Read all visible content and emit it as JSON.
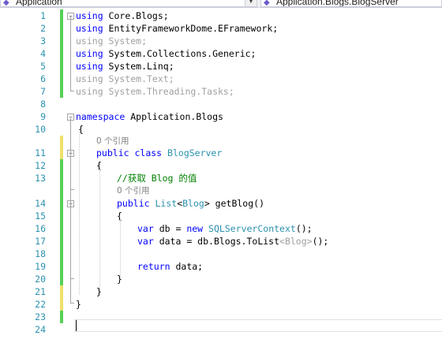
{
  "navigation": {
    "project_combo": "Application",
    "type_combo": "Application.Blogs.BlogServer"
  },
  "code_lines": [
    {
      "num": "1",
      "tokens": [
        {
          "t": "using",
          "c": "kw"
        },
        {
          "t": " Core.Blogs;",
          "c": ""
        }
      ]
    },
    {
      "num": "2",
      "tokens": [
        {
          "t": "using",
          "c": "kw"
        },
        {
          "t": " EntityFrameworkDome.EFramework;",
          "c": ""
        }
      ]
    },
    {
      "num": "3",
      "tokens": [
        {
          "t": "using System;",
          "c": "faded"
        }
      ]
    },
    {
      "num": "4",
      "tokens": [
        {
          "t": "using",
          "c": "kw"
        },
        {
          "t": " System.Collections.Generic;",
          "c": ""
        }
      ]
    },
    {
      "num": "5",
      "tokens": [
        {
          "t": "using",
          "c": "kw"
        },
        {
          "t": " System.Linq;",
          "c": ""
        }
      ]
    },
    {
      "num": "6",
      "tokens": [
        {
          "t": "using System.Text;",
          "c": "faded"
        }
      ]
    },
    {
      "num": "7",
      "tokens": [
        {
          "t": "using System.Threading.Tasks;",
          "c": "faded"
        }
      ]
    },
    {
      "num": "8",
      "tokens": []
    },
    {
      "num": "9",
      "tokens": [
        {
          "t": "namespace",
          "c": "kw"
        },
        {
          "t": " Application.Blogs",
          "c": ""
        }
      ]
    },
    {
      "num": "10",
      "tokens": [
        {
          "t": "{",
          "c": ""
        }
      ]
    },
    {
      "num": "11",
      "tokens": [
        {
          "t": "public",
          "c": "kw"
        },
        {
          "t": " ",
          "c": ""
        },
        {
          "t": "class",
          "c": "kw"
        },
        {
          "t": " ",
          "c": ""
        },
        {
          "t": "BlogServer",
          "c": "type"
        }
      ]
    },
    {
      "num": "12",
      "tokens": [
        {
          "t": "{",
          "c": ""
        }
      ]
    },
    {
      "num": "13",
      "tokens": [
        {
          "t": "//获取 Blog 的值",
          "c": "cmt"
        }
      ]
    },
    {
      "num": "14",
      "tokens": [
        {
          "t": "public",
          "c": "kw"
        },
        {
          "t": " ",
          "c": ""
        },
        {
          "t": "List",
          "c": "type"
        },
        {
          "t": "<",
          "c": ""
        },
        {
          "t": "Blog",
          "c": "type"
        },
        {
          "t": "> getBlog()",
          "c": ""
        }
      ]
    },
    {
      "num": "15",
      "tokens": [
        {
          "t": "{",
          "c": ""
        }
      ]
    },
    {
      "num": "16",
      "tokens": [
        {
          "t": "var",
          "c": "kw"
        },
        {
          "t": " db = ",
          "c": ""
        },
        {
          "t": "new",
          "c": "kw"
        },
        {
          "t": " ",
          "c": ""
        },
        {
          "t": "SQLServerContext",
          "c": "type"
        },
        {
          "t": "();",
          "c": ""
        }
      ]
    },
    {
      "num": "17",
      "tokens": [
        {
          "t": "var",
          "c": "kw"
        },
        {
          "t": " data = db.Blogs.ToList",
          "c": ""
        },
        {
          "t": "<Blog>",
          "c": "faded"
        },
        {
          "t": "();",
          "c": ""
        }
      ]
    },
    {
      "num": "18",
      "tokens": []
    },
    {
      "num": "19",
      "tokens": [
        {
          "t": "return",
          "c": "kw"
        },
        {
          "t": " data;",
          "c": ""
        }
      ]
    },
    {
      "num": "20",
      "tokens": [
        {
          "t": "}",
          "c": ""
        }
      ]
    },
    {
      "num": "21",
      "tokens": [
        {
          "t": "}",
          "c": ""
        }
      ]
    },
    {
      "num": "22",
      "tokens": [
        {
          "t": "}",
          "c": ""
        }
      ]
    },
    {
      "num": "23",
      "tokens": []
    },
    {
      "num": "24",
      "tokens": []
    }
  ],
  "codelens": [
    {
      "text": "0 个引用",
      "before_line": 11
    },
    {
      "text": "0 个引用",
      "before_line": 14
    }
  ],
  "colors": {
    "keyword": "#0000ff",
    "type": "#2b91af",
    "comment": "#008000",
    "faded": "#a0a0a0",
    "line_number": "#2b91af",
    "change_saved": "#57d05a",
    "change_unsaved": "#efe06a"
  }
}
